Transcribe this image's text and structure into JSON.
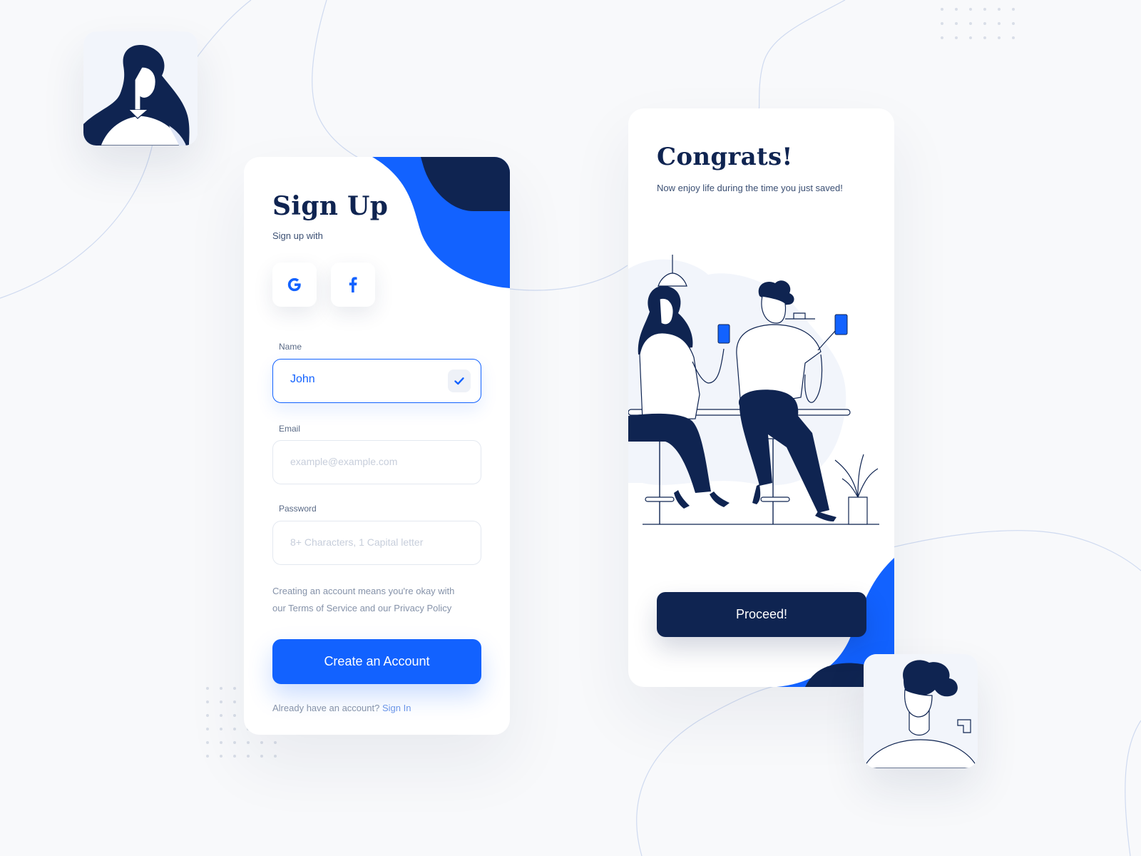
{
  "signup": {
    "title": "Sign Up",
    "subtitle": "Sign up with",
    "social": [
      {
        "name": "google",
        "glyph": "G"
      },
      {
        "name": "facebook",
        "glyph": "f"
      }
    ],
    "name_label": "Name",
    "name_value": "John",
    "email_label": "Email",
    "email_placeholder": "example@example.com",
    "password_label": "Password",
    "password_placeholder": "8+ Characters, 1 Capital letter",
    "terms_line1": "Creating an account means you're okay with",
    "terms_line2": "our Terms of Service and our  Privacy Policy",
    "create_label": "Create an Account",
    "have_account": "Already have an account?",
    "signin_label": "Sign In"
  },
  "congrats": {
    "title": "Congrats!",
    "subtitle": "Now enjoy life during the time you just saved!",
    "proceed_label": "Proceed!"
  },
  "colors": {
    "accent": "#1262ff",
    "navy": "#0f2451",
    "background": "#f8f9fb"
  }
}
